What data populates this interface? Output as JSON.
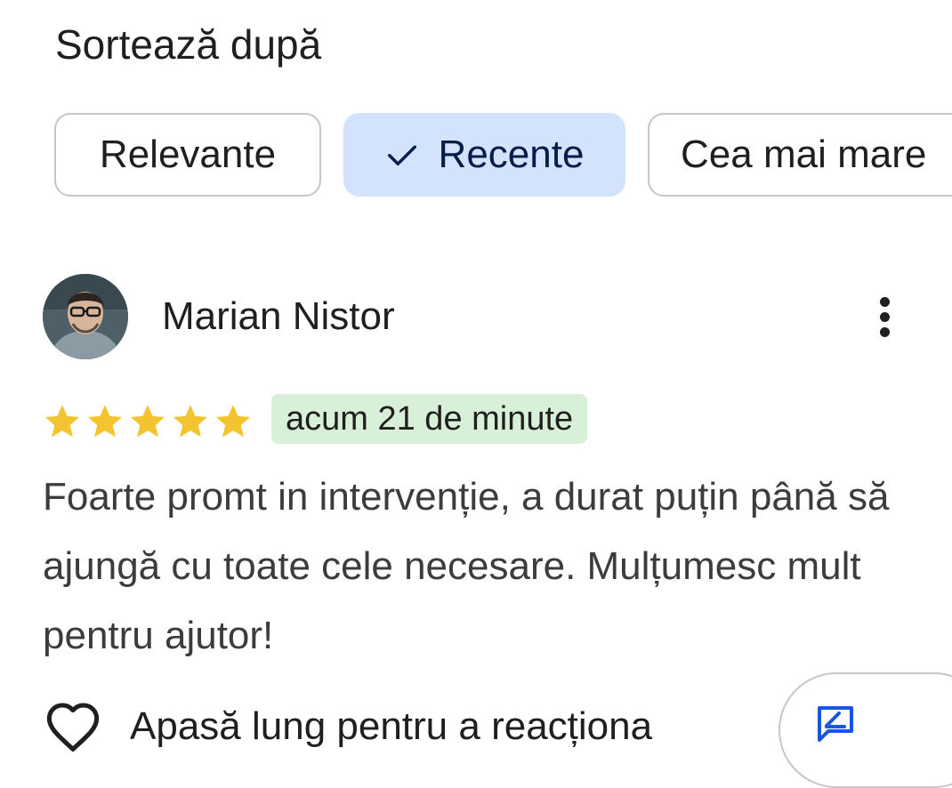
{
  "sort": {
    "title": "Sortează după",
    "options": [
      {
        "label": "Relevante",
        "selected": false
      },
      {
        "label": "Recente",
        "selected": true
      },
      {
        "label": "Cea mai mare",
        "selected": false
      }
    ]
  },
  "review": {
    "author": "Marian Nistor",
    "rating": 5,
    "time": "acum 21 de minute",
    "text": "Foarte promt in intervenție, a durat puțin până să ajungă cu toate cele necesare. Mulțumesc mult pentru ajutor!",
    "react_label": "Apasă lung pentru a reacționa"
  },
  "colors": {
    "star": "#f4c430",
    "selected_chip": "#d3e3fd",
    "time_badge": "#d7f0d7",
    "reply_icon": "#1a56db"
  },
  "icons": [
    "check-icon",
    "more-vert-icon",
    "star-icon",
    "heart-outline-icon",
    "reply-icon"
  ]
}
